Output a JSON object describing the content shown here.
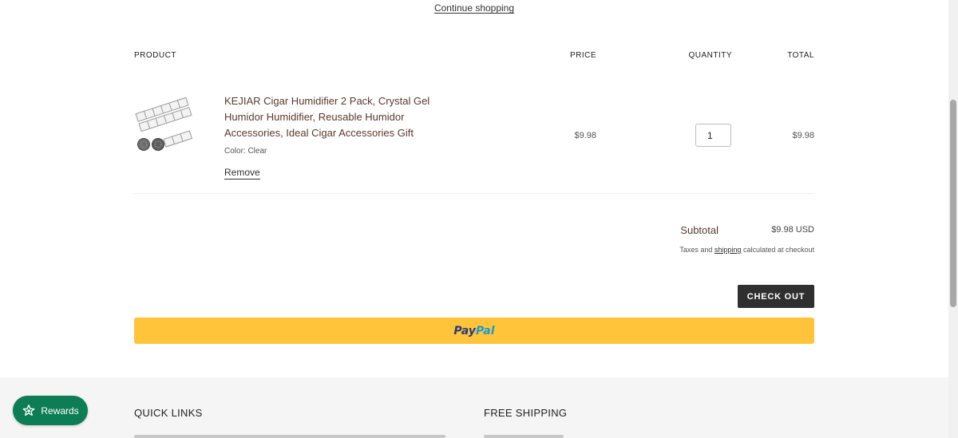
{
  "top": {
    "continue_link": "Continue shopping"
  },
  "table": {
    "headers": {
      "product": "PRODUCT",
      "price": "PRICE",
      "quantity": "QUANTITY",
      "total": "TOTAL"
    }
  },
  "item": {
    "name": "KEJIAR Cigar Humidifier 2 Pack, Crystal Gel Humidor Humidifier, Reusable Humidor Accessories, Ideal Cigar Accessories Gift",
    "variant": "Color: Clear",
    "remove_label": "Remove",
    "price": "$9.98",
    "quantity": "1",
    "total": "$9.98"
  },
  "summary": {
    "subtotal_label": "Subtotal",
    "subtotal_value": "$9.98 USD",
    "tax_prefix": "Taxes and ",
    "tax_link": "shipping",
    "tax_suffix": " calculated at checkout",
    "checkout_label": "CHECK OUT",
    "paypal_part1": "Pay",
    "paypal_part2": "Pal"
  },
  "footer": {
    "quick_links_heading": "QUICK LINKS",
    "free_shipping_heading": "FREE SHIPPING"
  },
  "rewards": {
    "label": "Rewards"
  },
  "colors": {
    "checkout_bg": "#2f2f2f",
    "paypal_bg": "#ffc439",
    "rewards_bg": "#0d7d55",
    "product_title": "#5a3a2e",
    "footer_bg": "#f5f5f5"
  },
  "icons": {
    "rewards": "star-badge-icon",
    "product": "product-thumbnail"
  }
}
